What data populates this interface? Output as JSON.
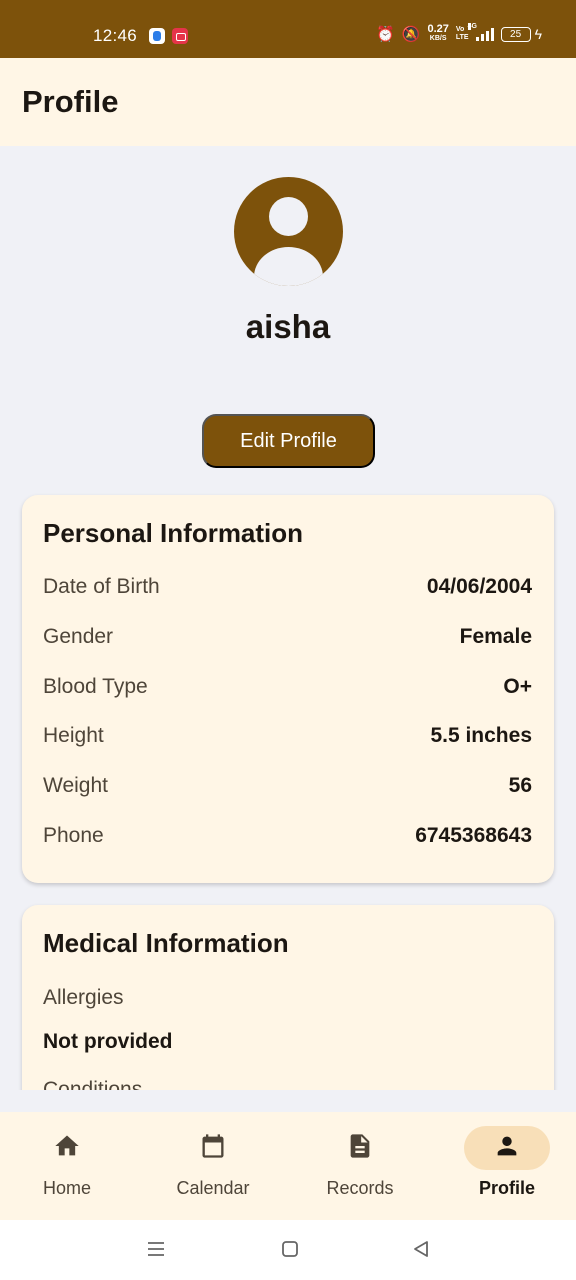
{
  "status_bar": {
    "time": "12:46",
    "net_speed": "0.27",
    "net_unit": "KB/S",
    "volte_top": "Vo",
    "volte_bottom": "LTE",
    "network": "4G",
    "battery": "25"
  },
  "header": {
    "title": "Profile"
  },
  "profile": {
    "name": "aisha",
    "edit_label": "Edit Profile"
  },
  "personal": {
    "title": "Personal Information",
    "rows": [
      {
        "label": "Date of Birth",
        "value": "04/06/2004"
      },
      {
        "label": "Gender",
        "value": "Female"
      },
      {
        "label": "Blood Type",
        "value": "O+"
      },
      {
        "label": "Height",
        "value": "5.5 inches"
      },
      {
        "label": "Weight",
        "value": "56"
      },
      {
        "label": "Phone",
        "value": "6745368643"
      }
    ]
  },
  "medical": {
    "title": "Medical Information",
    "allergies_label": "Allergies",
    "allergies_value": "Not provided",
    "conditions_label": "Conditions"
  },
  "bottom_nav": {
    "items": [
      {
        "label": "Home",
        "icon": "home-icon"
      },
      {
        "label": "Calendar",
        "icon": "calendar-icon"
      },
      {
        "label": "Records",
        "icon": "document-icon"
      },
      {
        "label": "Profile",
        "icon": "person-icon",
        "active": true
      }
    ]
  },
  "colors": {
    "primary": "#7d520b",
    "surface": "#fff6e6",
    "background": "#f0f1f6",
    "active_pill": "#f8dfb8"
  }
}
